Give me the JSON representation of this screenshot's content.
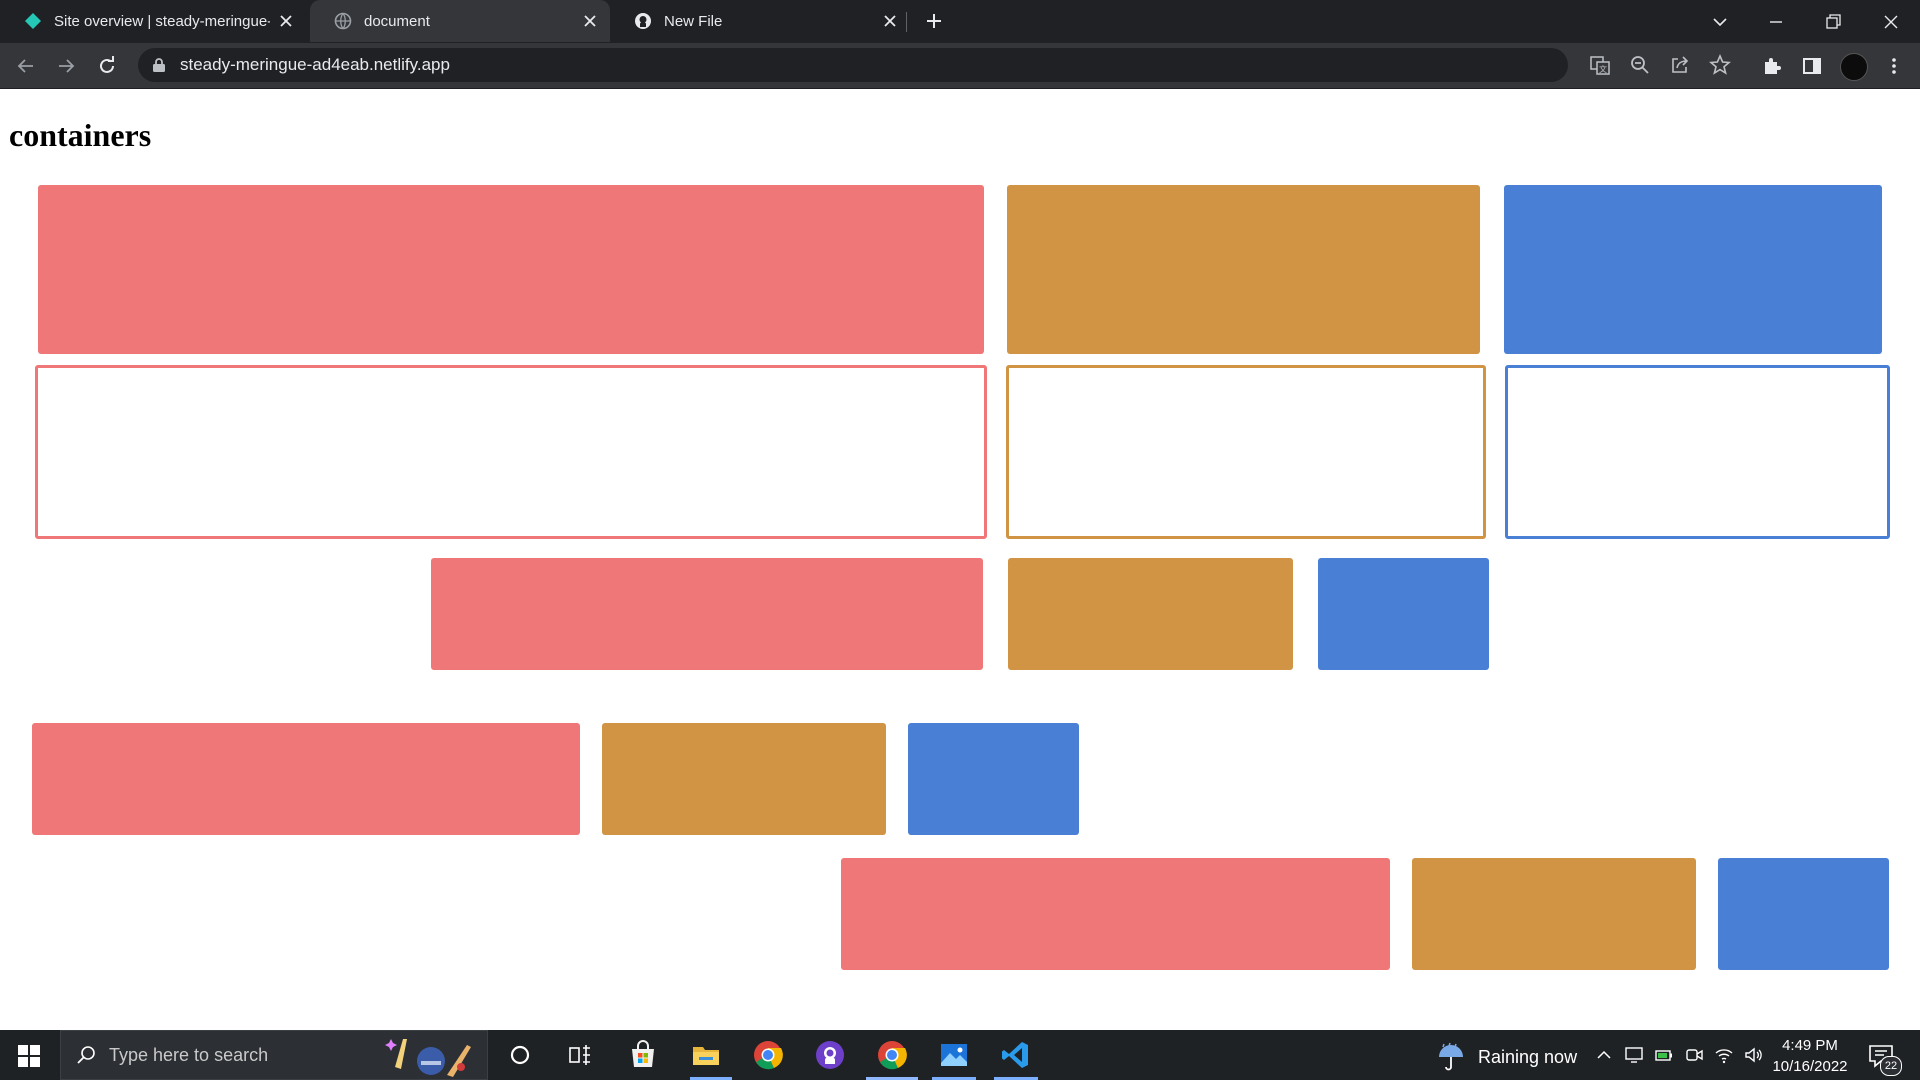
{
  "browser": {
    "tabs": [
      {
        "title": "Site overview | steady-meringue-",
        "icon": "netlify-icon",
        "active": false
      },
      {
        "title": "document",
        "icon": "globe-icon",
        "active": true
      },
      {
        "title": "New File",
        "icon": "github-icon",
        "active": false
      }
    ],
    "url": "steady-meringue-ad4eab.netlify.app"
  },
  "page": {
    "heading": "containers",
    "colors": {
      "red": "#ef7777",
      "orange": "#d19344",
      "blue": "#4980d6"
    },
    "rows": [
      {
        "style": "filled",
        "items": [
          "red",
          "orange",
          "blue"
        ]
      },
      {
        "style": "outlined",
        "items": [
          "red",
          "orange",
          "blue"
        ]
      },
      {
        "style": "filled",
        "items": [
          "red",
          "orange",
          "blue"
        ]
      },
      {
        "style": "filled",
        "items": [
          "red",
          "orange",
          "blue"
        ]
      },
      {
        "style": "filled",
        "items": [
          "red",
          "orange",
          "blue"
        ]
      }
    ]
  },
  "taskbar": {
    "search_placeholder": "Type here to search",
    "weather": "Raining now",
    "time": "4:49 PM",
    "date": "10/16/2022",
    "notifications": "22"
  }
}
